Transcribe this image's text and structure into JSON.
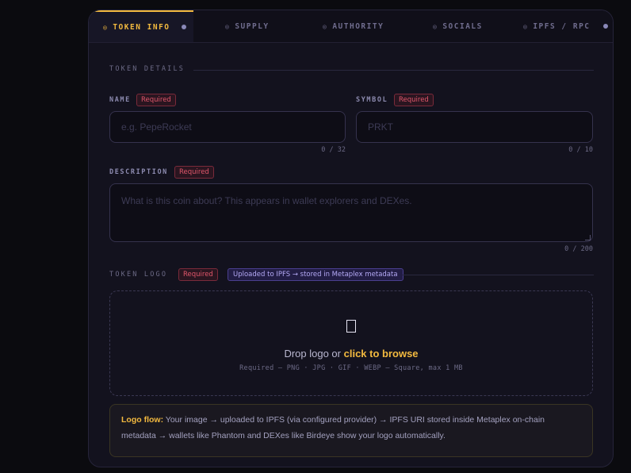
{
  "tabs": [
    {
      "label": "TOKEN INFO",
      "icon": "◎",
      "active": true,
      "dot": true
    },
    {
      "label": "SUPPLY",
      "icon": "◎"
    },
    {
      "label": "AUTHORITY",
      "icon": "◎"
    },
    {
      "label": "SOCIALS",
      "icon": "◎"
    },
    {
      "label": "IPFS / RPC",
      "icon": "◎",
      "dot": true
    }
  ],
  "details": {
    "section_title": "TOKEN DETAILS",
    "required": "Required",
    "name": {
      "label": "NAME",
      "placeholder": "e.g. PepeRocket",
      "counter": "0 / 32"
    },
    "symbol": {
      "label": "SYMBOL",
      "placeholder": "PRKT",
      "counter": "0 / 10"
    },
    "description": {
      "label": "DESCRIPTION",
      "placeholder": "What is this coin about? This appears in wallet explorers and DEXes.",
      "counter": "0 / 200"
    }
  },
  "logo": {
    "section_title": "TOKEN LOGO",
    "required": "Required",
    "info_badge": "Uploaded to IPFS → stored in Metaplex metadata",
    "drop_text": "Drop logo or ",
    "browse_link": "click to browse",
    "hint": "Required — PNG · JPG · GIF · WEBP — Square, max 1 MB"
  },
  "flow": {
    "title": "Logo flow:",
    "text": " Your image → uploaded to IPFS (via configured provider) → IPFS URI stored inside Metaplex on-chain metadata → wallets like Phantom and DEXes like Birdeye show your logo automatically."
  }
}
